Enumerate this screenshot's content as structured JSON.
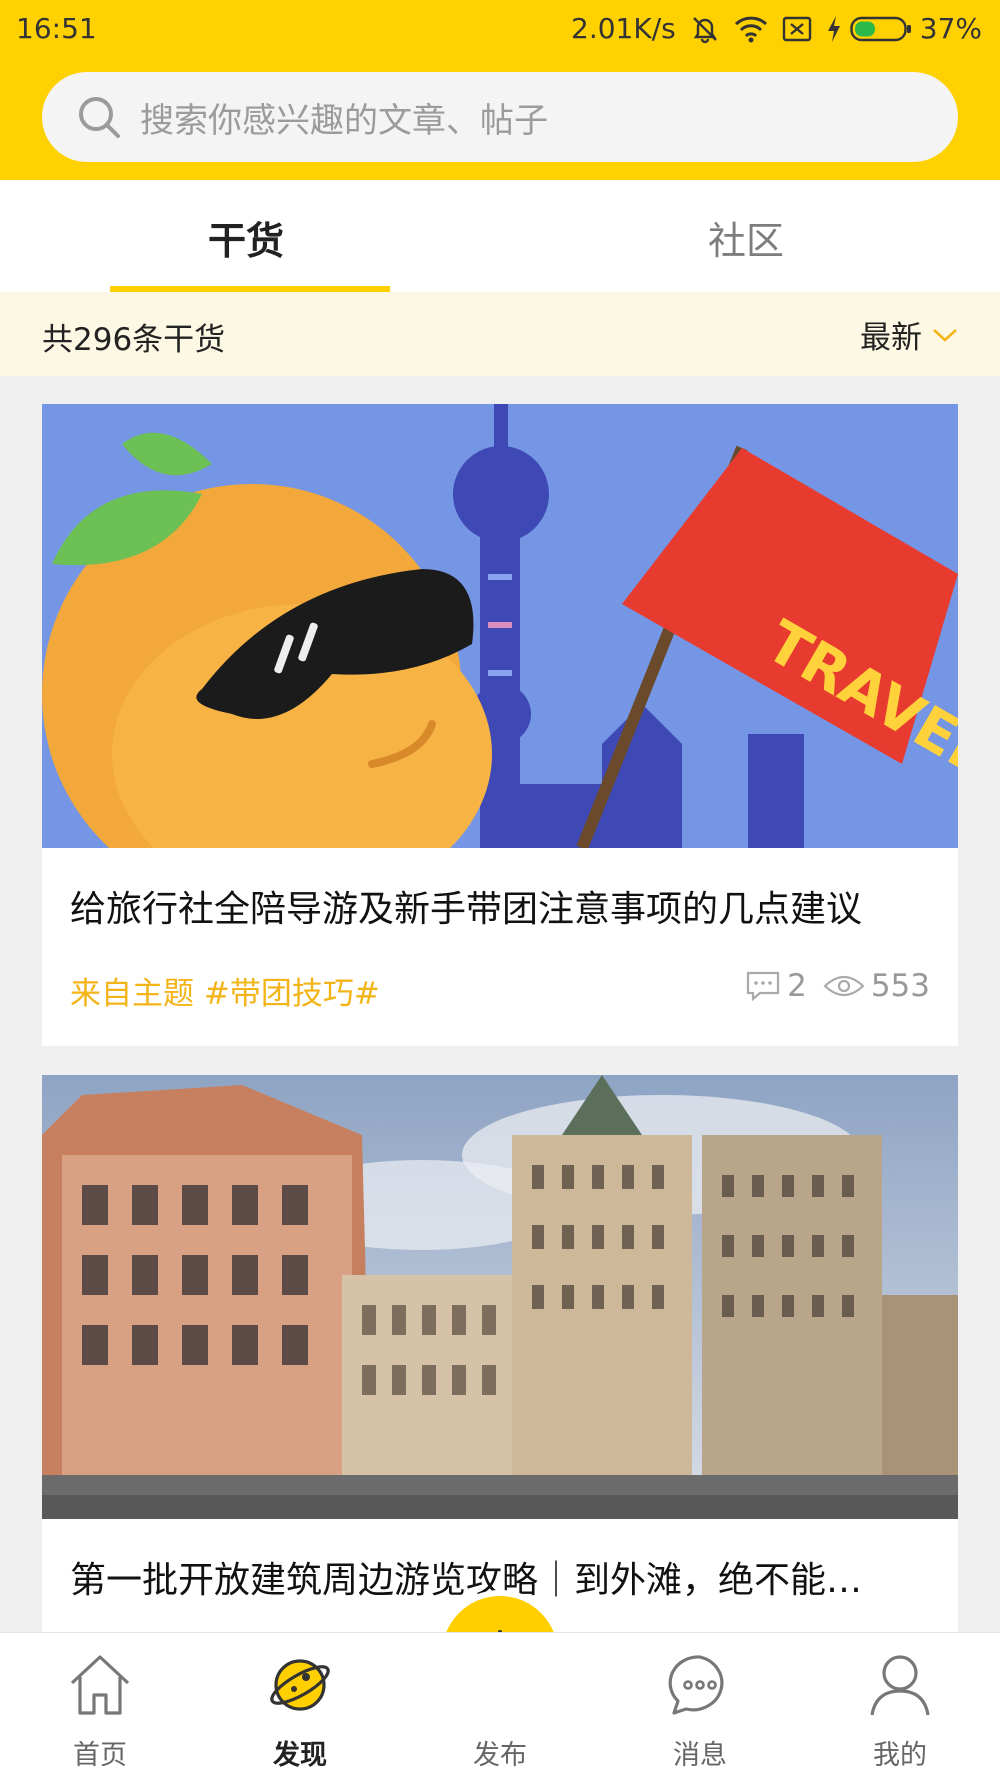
{
  "status_bar": {
    "time": "16:51",
    "network_speed": "2.01K/s",
    "battery": "37%",
    "icons": [
      "mute-icon",
      "wifi-icon",
      "no-sim-icon",
      "charging-icon",
      "battery-icon"
    ]
  },
  "search": {
    "placeholder": "搜索你感兴趣的文章、帖子"
  },
  "tabs": [
    {
      "label": "干货",
      "active": true
    },
    {
      "label": "社区",
      "active": false
    }
  ],
  "list_header": {
    "count_text": "共296条干货",
    "sort_label": "最新"
  },
  "articles": [
    {
      "title": "给旅行社全陪导游及新手带团注意事项的几点建议",
      "topic": "来自主题 #带团技巧#",
      "comments": "2",
      "views": "553",
      "image_text": "TRAVEL"
    },
    {
      "title": "第一批开放建筑周边游览攻略｜到外滩，绝不能…"
    }
  ],
  "bottom_nav": [
    {
      "label": "首页",
      "icon": "home-icon",
      "active": false
    },
    {
      "label": "发现",
      "icon": "planet-icon",
      "active": true
    },
    {
      "label": "发布",
      "icon": "plus-icon",
      "active": false
    },
    {
      "label": "消息",
      "icon": "chat-bubble-icon",
      "active": false
    },
    {
      "label": "我的",
      "icon": "user-icon",
      "active": false
    }
  ],
  "colors": {
    "brand_yellow": "#ffd100",
    "accent_yellow": "#ffcf00",
    "topic_orange": "#f3b418"
  }
}
